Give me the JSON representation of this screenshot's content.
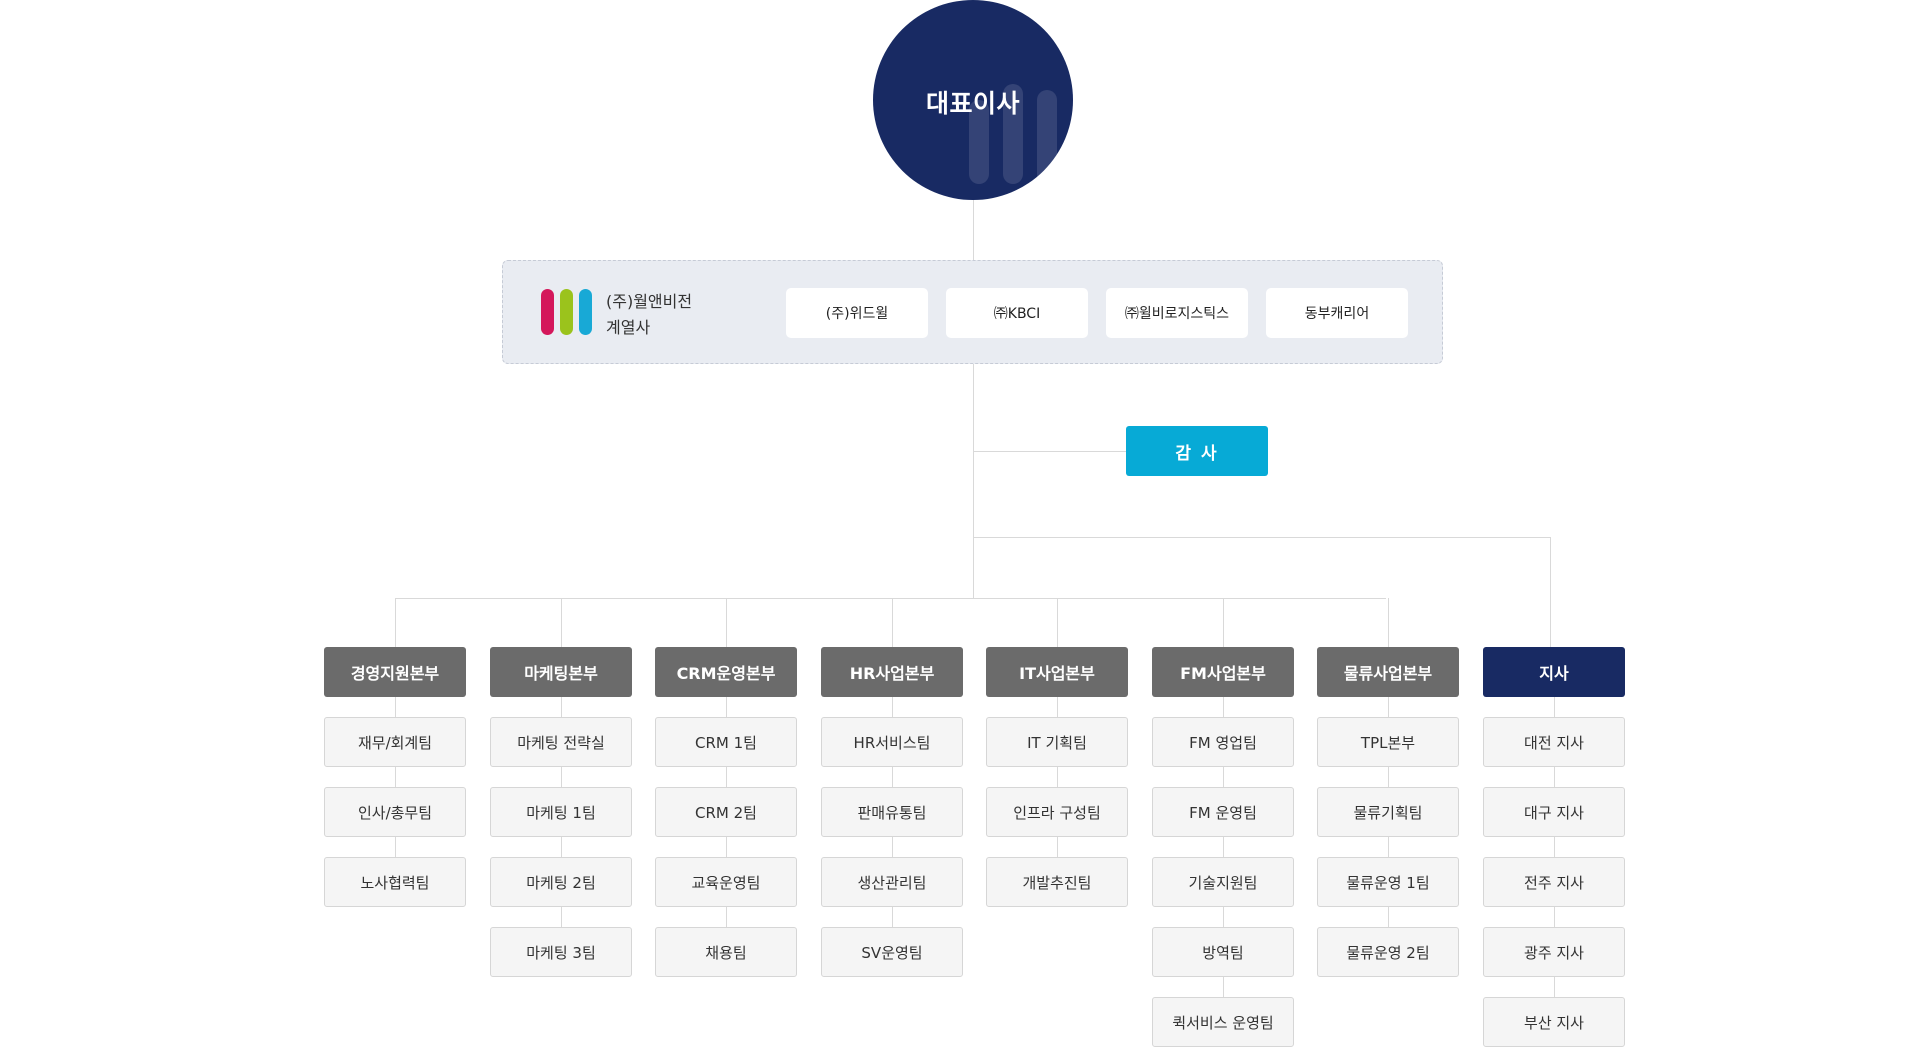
{
  "ceo": {
    "label": "대표이사"
  },
  "affiliates": {
    "title_line1": "(주)월앤비전",
    "title_line2": "계열사",
    "logo_colors": [
      "#d4175b",
      "#9bc31c",
      "#18a9d6"
    ],
    "companies": [
      "(주)위드윌",
      "㈜KBCI",
      "㈜윌비로지스틱스",
      "동부캐리어"
    ]
  },
  "audit": {
    "label": "감 사"
  },
  "colors": {
    "navy": "#182a63",
    "gray_head": "#6b6b6b",
    "audit_blue": "#07aad6"
  },
  "divisions": [
    {
      "name": "경영지원본부",
      "style": "gray",
      "teams": [
        "재무/회계팀",
        "인사/총무팀",
        "노사협력팀"
      ]
    },
    {
      "name": "마케팅본부",
      "style": "gray",
      "teams": [
        "마케팅 전략실",
        "마케팅 1팀",
        "마케팅 2팀",
        "마케팅 3팀"
      ]
    },
    {
      "name": "CRM운영본부",
      "style": "gray",
      "teams": [
        "CRM 1팀",
        "CRM 2팀",
        "교육운영팀",
        "채용팀"
      ]
    },
    {
      "name": "HR사업본부",
      "style": "gray",
      "teams": [
        "HR서비스팀",
        "판매유통팀",
        "생산관리팀",
        "SV운영팀"
      ]
    },
    {
      "name": "IT사업본부",
      "style": "gray",
      "teams": [
        "IT 기획팀",
        "인프라 구성팀",
        "개발추진팀"
      ]
    },
    {
      "name": "FM사업본부",
      "style": "gray",
      "teams": [
        "FM 영업팀",
        "FM 운영팀",
        "기술지원팀",
        "방역팀",
        "퀵서비스 운영팀"
      ]
    },
    {
      "name": "물류사업본부",
      "style": "gray",
      "teams": [
        "TPL본부",
        "물류기획팀",
        "물류운영 1팀",
        "물류운영 2팀"
      ]
    },
    {
      "name": "지사",
      "style": "navy",
      "teams": [
        "대전 지사",
        "대구 지사",
        "전주 지사",
        "광주 지사",
        "부산 지사"
      ]
    }
  ]
}
